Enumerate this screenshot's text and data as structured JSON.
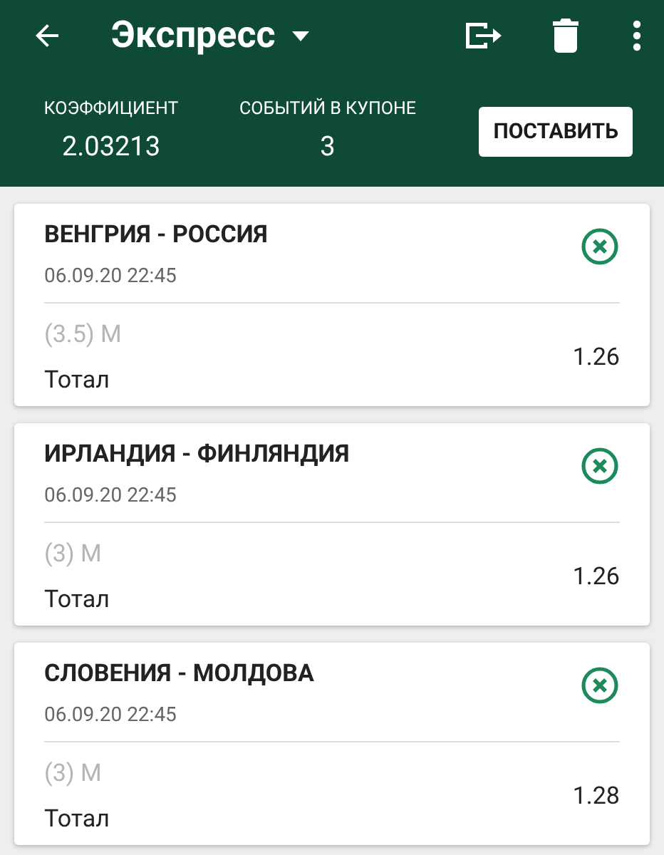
{
  "toolbar": {
    "title": "Экспресс"
  },
  "summary": {
    "coefficient_label": "КОЭФФИЦИЕНТ",
    "coefficient": "2.03213",
    "events_label": "СОБЫТИЙ В КУПОНЕ",
    "events": "3",
    "bet_button": "ПОСТАВИТЬ"
  },
  "bets": [
    {
      "match": "ВЕНГРИЯ - РОССИЯ",
      "datetime": "06.09.20 22:45",
      "outcome": "(3.5) М",
      "market": "Тотал",
      "odds": "1.26"
    },
    {
      "match": "ИРЛАНДИЯ - ФИНЛЯНДИЯ",
      "datetime": "06.09.20 22:45",
      "outcome": "(3) М",
      "market": "Тотал",
      "odds": "1.26"
    },
    {
      "match": "СЛОВЕНИЯ - МОЛДОВА",
      "datetime": "06.09.20 22:45",
      "outcome": "(3) М",
      "market": "Тотал",
      "odds": "1.28"
    }
  ]
}
